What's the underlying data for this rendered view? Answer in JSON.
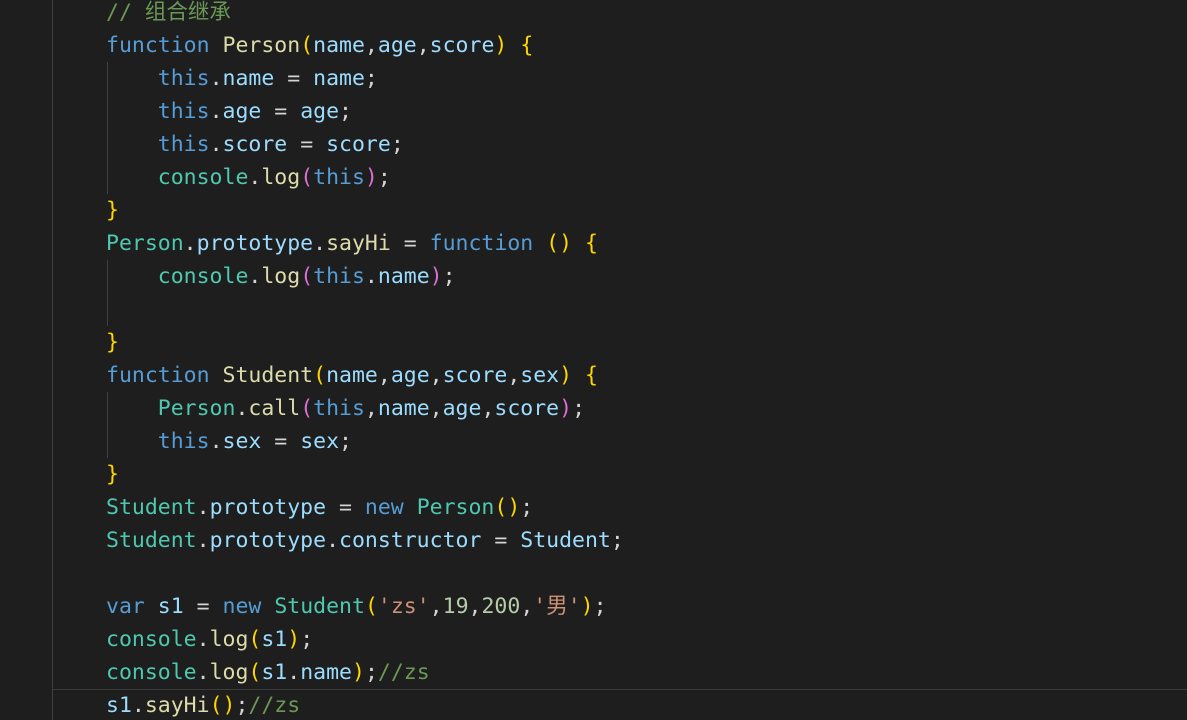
{
  "editor": {
    "theme_colors": {
      "background": "#1e1e1e",
      "comment": "#6a9955",
      "keyword": "#569cd6",
      "function": "#dcdcaa",
      "type": "#4ec9b0",
      "variable": "#9cdcfe",
      "string": "#ce9178",
      "number": "#b5cea8",
      "bracket_level1": "#ffd700",
      "bracket_level2": "#da70d6"
    },
    "cursor_line": 22,
    "lines": [
      [
        {
          "t": "// 组合继承",
          "c": "cmt"
        }
      ],
      [
        {
          "t": "function",
          "c": "kw"
        },
        {
          "t": " ",
          "c": "pl"
        },
        {
          "t": "Person",
          "c": "fn"
        },
        {
          "t": "(",
          "c": "br1"
        },
        {
          "t": "name",
          "c": "vr"
        },
        {
          "t": ",",
          "c": "pl"
        },
        {
          "t": "age",
          "c": "vr"
        },
        {
          "t": ",",
          "c": "pl"
        },
        {
          "t": "score",
          "c": "vr"
        },
        {
          "t": ")",
          "c": "br1"
        },
        {
          "t": " ",
          "c": "pl"
        },
        {
          "t": "{",
          "c": "br1"
        }
      ],
      [
        {
          "t": "    ",
          "c": "pl"
        },
        {
          "t": "this",
          "c": "kw"
        },
        {
          "t": ".",
          "c": "pl"
        },
        {
          "t": "name",
          "c": "vr"
        },
        {
          "t": " = ",
          "c": "pl"
        },
        {
          "t": "name",
          "c": "vr"
        },
        {
          "t": ";",
          "c": "pl"
        }
      ],
      [
        {
          "t": "    ",
          "c": "pl"
        },
        {
          "t": "this",
          "c": "kw"
        },
        {
          "t": ".",
          "c": "pl"
        },
        {
          "t": "age",
          "c": "vr"
        },
        {
          "t": " = ",
          "c": "pl"
        },
        {
          "t": "age",
          "c": "vr"
        },
        {
          "t": ";",
          "c": "pl"
        }
      ],
      [
        {
          "t": "    ",
          "c": "pl"
        },
        {
          "t": "this",
          "c": "kw"
        },
        {
          "t": ".",
          "c": "pl"
        },
        {
          "t": "score",
          "c": "vr"
        },
        {
          "t": " = ",
          "c": "pl"
        },
        {
          "t": "score",
          "c": "vr"
        },
        {
          "t": ";",
          "c": "pl"
        }
      ],
      [
        {
          "t": "    ",
          "c": "pl"
        },
        {
          "t": "console",
          "c": "ty"
        },
        {
          "t": ".",
          "c": "pl"
        },
        {
          "t": "log",
          "c": "fn"
        },
        {
          "t": "(",
          "c": "br2"
        },
        {
          "t": "this",
          "c": "kw"
        },
        {
          "t": ")",
          "c": "br2"
        },
        {
          "t": ";",
          "c": "pl"
        }
      ],
      [
        {
          "t": "}",
          "c": "br1"
        }
      ],
      [
        {
          "t": "Person",
          "c": "ty"
        },
        {
          "t": ".",
          "c": "pl"
        },
        {
          "t": "prototype",
          "c": "vr"
        },
        {
          "t": ".",
          "c": "pl"
        },
        {
          "t": "sayHi",
          "c": "fn"
        },
        {
          "t": " = ",
          "c": "pl"
        },
        {
          "t": "function",
          "c": "kw"
        },
        {
          "t": " ",
          "c": "pl"
        },
        {
          "t": "()",
          "c": "br1"
        },
        {
          "t": " ",
          "c": "pl"
        },
        {
          "t": "{",
          "c": "br1"
        }
      ],
      [
        {
          "t": "    ",
          "c": "pl"
        },
        {
          "t": "console",
          "c": "ty"
        },
        {
          "t": ".",
          "c": "pl"
        },
        {
          "t": "log",
          "c": "fn"
        },
        {
          "t": "(",
          "c": "br2"
        },
        {
          "t": "this",
          "c": "kw"
        },
        {
          "t": ".",
          "c": "pl"
        },
        {
          "t": "name",
          "c": "vr"
        },
        {
          "t": ")",
          "c": "br2"
        },
        {
          "t": ";",
          "c": "pl"
        }
      ],
      [],
      [
        {
          "t": "}",
          "c": "br1"
        }
      ],
      [
        {
          "t": "function",
          "c": "kw"
        },
        {
          "t": " ",
          "c": "pl"
        },
        {
          "t": "Student",
          "c": "fn"
        },
        {
          "t": "(",
          "c": "br1"
        },
        {
          "t": "name",
          "c": "vr"
        },
        {
          "t": ",",
          "c": "pl"
        },
        {
          "t": "age",
          "c": "vr"
        },
        {
          "t": ",",
          "c": "pl"
        },
        {
          "t": "score",
          "c": "vr"
        },
        {
          "t": ",",
          "c": "pl"
        },
        {
          "t": "sex",
          "c": "vr"
        },
        {
          "t": ")",
          "c": "br1"
        },
        {
          "t": " ",
          "c": "pl"
        },
        {
          "t": "{",
          "c": "br1"
        }
      ],
      [
        {
          "t": "    ",
          "c": "pl"
        },
        {
          "t": "Person",
          "c": "ty"
        },
        {
          "t": ".",
          "c": "pl"
        },
        {
          "t": "call",
          "c": "fn"
        },
        {
          "t": "(",
          "c": "br2"
        },
        {
          "t": "this",
          "c": "kw"
        },
        {
          "t": ",",
          "c": "pl"
        },
        {
          "t": "name",
          "c": "vr"
        },
        {
          "t": ",",
          "c": "pl"
        },
        {
          "t": "age",
          "c": "vr"
        },
        {
          "t": ",",
          "c": "pl"
        },
        {
          "t": "score",
          "c": "vr"
        },
        {
          "t": ")",
          "c": "br2"
        },
        {
          "t": ";",
          "c": "pl"
        }
      ],
      [
        {
          "t": "    ",
          "c": "pl"
        },
        {
          "t": "this",
          "c": "kw"
        },
        {
          "t": ".",
          "c": "pl"
        },
        {
          "t": "sex",
          "c": "vr"
        },
        {
          "t": " = ",
          "c": "pl"
        },
        {
          "t": "sex",
          "c": "vr"
        },
        {
          "t": ";",
          "c": "pl"
        }
      ],
      [
        {
          "t": "}",
          "c": "br1"
        }
      ],
      [
        {
          "t": "Student",
          "c": "ty"
        },
        {
          "t": ".",
          "c": "pl"
        },
        {
          "t": "prototype",
          "c": "vr"
        },
        {
          "t": " = ",
          "c": "pl"
        },
        {
          "t": "new",
          "c": "kw"
        },
        {
          "t": " ",
          "c": "pl"
        },
        {
          "t": "Person",
          "c": "ty"
        },
        {
          "t": "()",
          "c": "br1"
        },
        {
          "t": ";",
          "c": "pl"
        }
      ],
      [
        {
          "t": "Student",
          "c": "ty"
        },
        {
          "t": ".",
          "c": "pl"
        },
        {
          "t": "prototype",
          "c": "vr"
        },
        {
          "t": ".",
          "c": "pl"
        },
        {
          "t": "constructor",
          "c": "vr"
        },
        {
          "t": " = ",
          "c": "pl"
        },
        {
          "t": "Student",
          "c": "vr"
        },
        {
          "t": ";",
          "c": "pl"
        }
      ],
      [],
      [
        {
          "t": "var",
          "c": "kw"
        },
        {
          "t": " ",
          "c": "pl"
        },
        {
          "t": "s1",
          "c": "vr"
        },
        {
          "t": " = ",
          "c": "pl"
        },
        {
          "t": "new",
          "c": "kw"
        },
        {
          "t": " ",
          "c": "pl"
        },
        {
          "t": "Student",
          "c": "ty"
        },
        {
          "t": "(",
          "c": "br1"
        },
        {
          "t": "'zs'",
          "c": "str"
        },
        {
          "t": ",",
          "c": "pl"
        },
        {
          "t": "19",
          "c": "num"
        },
        {
          "t": ",",
          "c": "pl"
        },
        {
          "t": "200",
          "c": "num"
        },
        {
          "t": ",",
          "c": "pl"
        },
        {
          "t": "'男'",
          "c": "str"
        },
        {
          "t": ")",
          "c": "br1"
        },
        {
          "t": ";",
          "c": "pl"
        }
      ],
      [
        {
          "t": "console",
          "c": "ty"
        },
        {
          "t": ".",
          "c": "pl"
        },
        {
          "t": "log",
          "c": "fn"
        },
        {
          "t": "(",
          "c": "br1"
        },
        {
          "t": "s1",
          "c": "vr"
        },
        {
          "t": ")",
          "c": "br1"
        },
        {
          "t": ";",
          "c": "pl"
        }
      ],
      [
        {
          "t": "console",
          "c": "ty"
        },
        {
          "t": ".",
          "c": "pl"
        },
        {
          "t": "log",
          "c": "fn"
        },
        {
          "t": "(",
          "c": "br1"
        },
        {
          "t": "s1",
          "c": "vr"
        },
        {
          "t": ".",
          "c": "pl"
        },
        {
          "t": "name",
          "c": "vr"
        },
        {
          "t": ")",
          "c": "br1"
        },
        {
          "t": ";",
          "c": "pl"
        },
        {
          "t": "//zs",
          "c": "cmt"
        }
      ],
      [
        {
          "t": "s1",
          "c": "vr"
        },
        {
          "t": ".",
          "c": "pl"
        },
        {
          "t": "sayHi",
          "c": "fn"
        },
        {
          "t": "()",
          "c": "br1"
        },
        {
          "t": ";",
          "c": "pl"
        },
        {
          "t": "//zs",
          "c": "cmt"
        }
      ]
    ]
  }
}
